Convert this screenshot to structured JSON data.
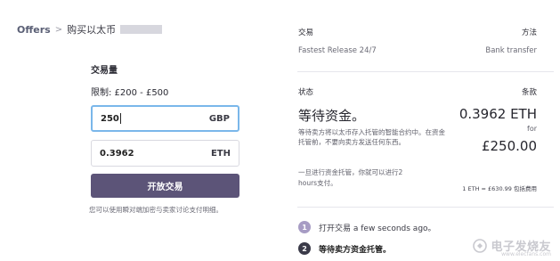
{
  "breadcrumb": {
    "root": "Offers",
    "separator": ">",
    "current": "购买以太币"
  },
  "form": {
    "amount_label": "交易量",
    "limit_text": "限制: £200 - £500",
    "gbp_value": "250",
    "gbp_currency": "GBP",
    "eth_value": "0.3962",
    "eth_currency": "ETH",
    "open_button": "开放交易",
    "footnote": "您可以使用瞬对端加密与卖家讨论支付明细。"
  },
  "panel": {
    "trade_label": "交易",
    "method_label": "方法",
    "trade_value": "Fastest Release 24/7",
    "method_value": "Bank transfer",
    "status_label": "状态",
    "terms_label": "条款",
    "status_value": "等待资金。",
    "status_desc": "等待卖方将以太币存入托管的智能合约中。在资金托管前，不要向卖方发送任何东西。",
    "status_desc2": "一旦进行资金托管，你就可以进行2 hours支付。",
    "eth_amount": "0.3962 ETH",
    "for_text": "for",
    "gbp_amount": "£250.00",
    "rate_note": "1 ETH = £630.99 包括费用",
    "steps": [
      {
        "num": "1",
        "text": "打开交易 a few seconds ago。"
      },
      {
        "num": "2",
        "text": "等待卖方资金托管。"
      }
    ]
  },
  "watermark": {
    "text": "电子发烧友",
    "url": "www.elecfans.com"
  }
}
